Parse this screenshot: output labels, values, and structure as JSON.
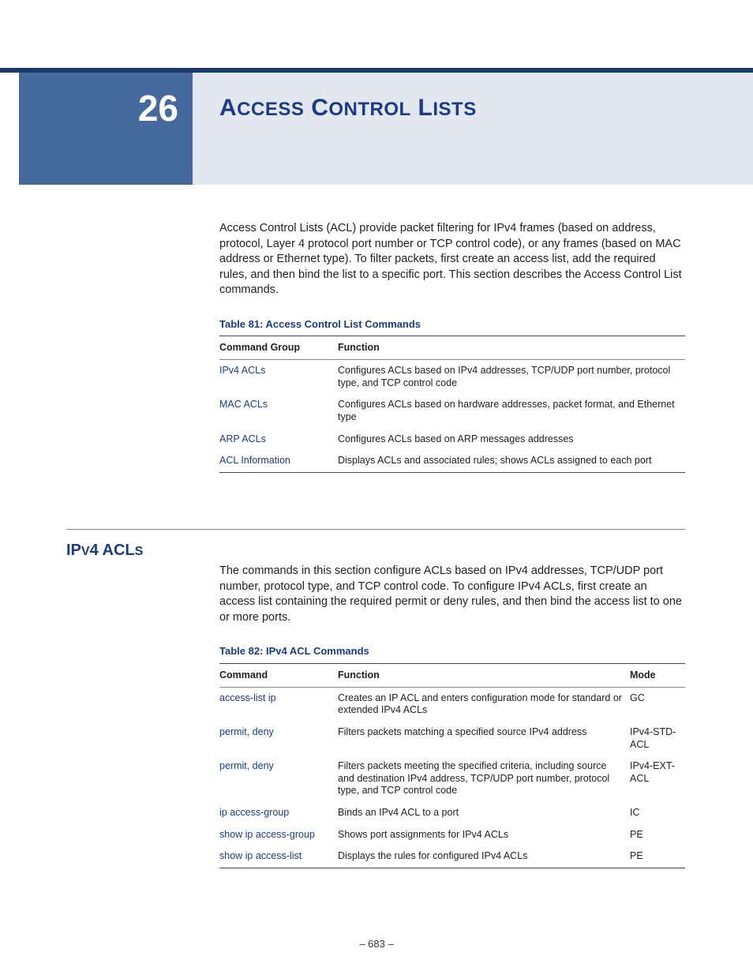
{
  "chapter": {
    "number": "26",
    "title_caps": [
      "A",
      "CCESS",
      " C",
      "ONTROL",
      " L",
      "ISTS"
    ]
  },
  "intro": "Access Control Lists (ACL) provide packet filtering for IPv4 frames (based on address, protocol, Layer 4 protocol port number or TCP control code), or any frames (based on MAC address or Ethernet type). To filter packets, first create an access list, add the required rules, and then bind the list to a specific port. This section describes the Access Control List commands.",
  "table81": {
    "caption": "Table 81: Access Control List Commands",
    "headers": {
      "c1": "Command Group",
      "c2": "Function"
    },
    "rows": [
      {
        "group": "IPv4 ACLs",
        "func": "Configures ACLs based on IPv4 addresses, TCP/UDP port number, protocol type, and TCP control code"
      },
      {
        "group": "MAC ACLs",
        "func": "Configures ACLs based on hardware addresses, packet format, and Ethernet type"
      },
      {
        "group": "ARP ACLs",
        "func": "Configures ACLs based on ARP messages addresses"
      },
      {
        "group": "ACL Information",
        "func": "Displays ACLs and associated rules; shows ACLs assigned to each port"
      }
    ]
  },
  "section": {
    "heading_caps": [
      "IP",
      "V",
      "4 ACL",
      "S"
    ],
    "para": "The commands in this section configure ACLs based on IPv4 addresses, TCP/UDP port number, protocol type, and TCP control code. To configure IPv4 ACLs, first create an access list containing the required permit or deny rules, and then bind the access list to one or more ports."
  },
  "table82": {
    "caption": "Table 82: IPv4 ACL Commands",
    "headers": {
      "c1": "Command",
      "c2": "Function",
      "c3": "Mode"
    },
    "rows": [
      {
        "cmd": "access-list ip",
        "func": "Creates an IP ACL and enters configuration mode for standard or extended IPv4 ACLs",
        "mode": "GC"
      },
      {
        "cmd": "permit, deny",
        "func": "Filters packets matching a specified source IPv4 address",
        "mode": "IPv4-STD-ACL"
      },
      {
        "cmd": "permit, deny",
        "func": "Filters packets meeting the specified criteria, including source and destination IPv4 address, TCP/UDP port number, protocol type, and TCP control code",
        "mode": "IPv4-EXT-ACL"
      },
      {
        "cmd": "ip access-group",
        "func": "Binds an IPv4 ACL to a port",
        "mode": "IC"
      },
      {
        "cmd": "show ip access-group",
        "func": "Shows port assignments for IPv4 ACLs",
        "mode": "PE"
      },
      {
        "cmd": "show ip access-list",
        "func": "Displays the rules for configured IPv4 ACLs",
        "mode": "PE"
      }
    ]
  },
  "footer": {
    "page": "–  683  –"
  }
}
